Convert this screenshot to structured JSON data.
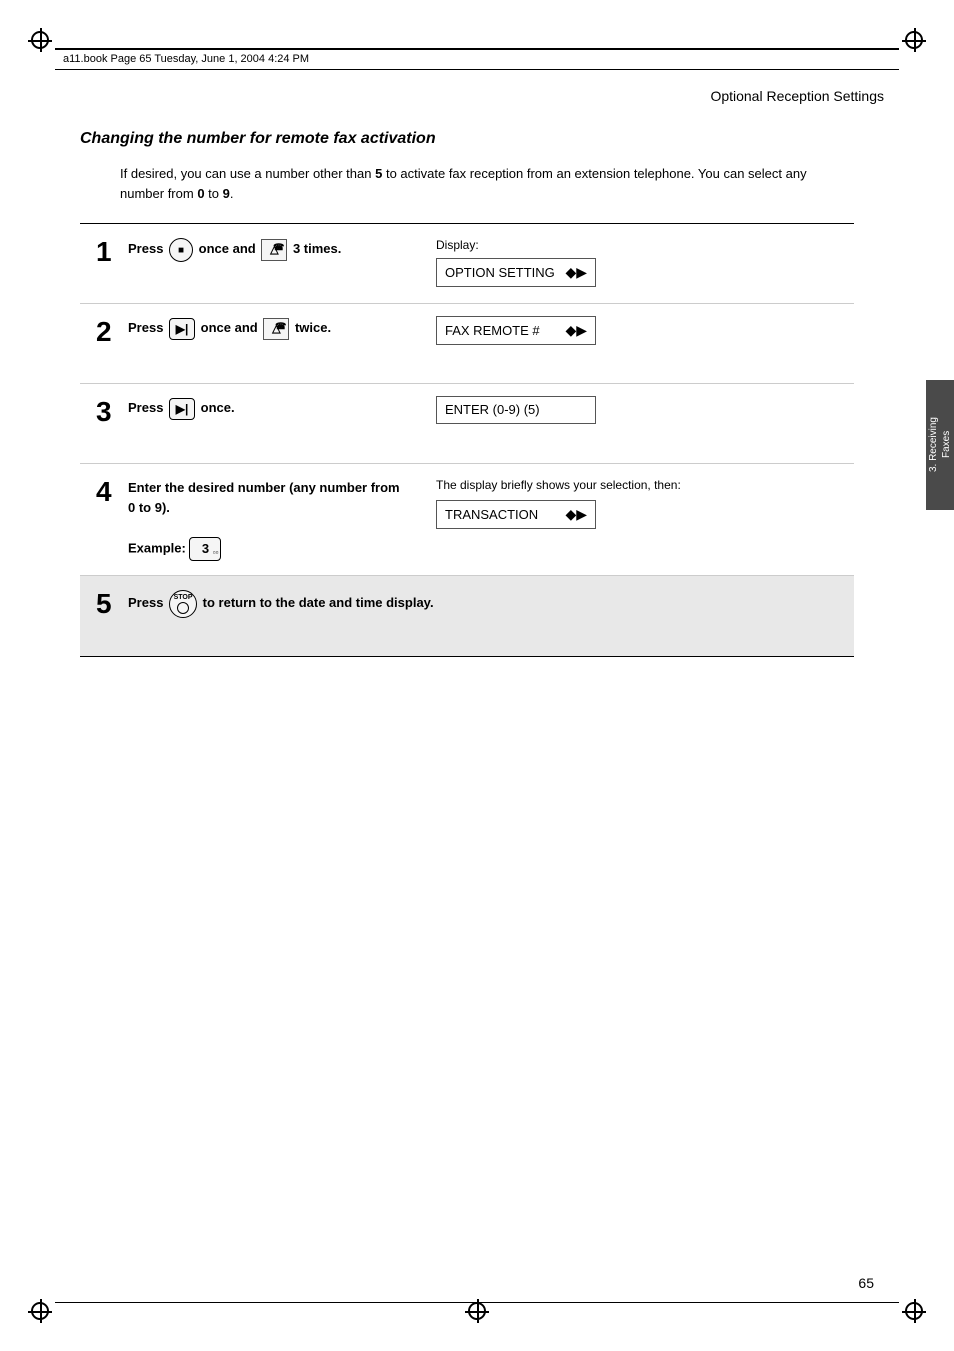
{
  "header": {
    "file_info": "a11.book   Page 65   Tuesday, June 1, 2004   4:24 PM"
  },
  "page_title": "Optional Reception Settings",
  "section_heading": "Changing the number for remote fax activation",
  "intro_text": "If desired, you can use a number other than 5 to activate fax reception from an extension telephone. You can select any number from 0 to 9.",
  "side_tab": {
    "line1": "3. Receiving",
    "line2": "Faxes"
  },
  "steps": [
    {
      "number": "1",
      "instruction": "Press  once and   3 times.",
      "display_label": "Display:",
      "lcd_text": "OPTION SETTING",
      "lcd_arrows": "◆▶"
    },
    {
      "number": "2",
      "instruction": "Press  once and   twice.",
      "display_label": "",
      "lcd_text": "FAX REMOTE #",
      "lcd_arrows": "◆▶"
    },
    {
      "number": "3",
      "instruction": "Press  once.",
      "display_label": "",
      "lcd_text": "ENTER (0-9) (5)",
      "lcd_arrows": ""
    },
    {
      "number": "4",
      "instruction_bold": "Enter the desired number (any number from 0 to 9).",
      "example_label": "Example:",
      "example_key": "3",
      "display_note": "The display briefly shows your selection, then:",
      "lcd_text": "TRANSACTION",
      "lcd_arrows": "◆▶"
    }
  ],
  "step5": {
    "number": "5",
    "instruction": "Press  to return to the date and time display."
  },
  "page_number": "65"
}
